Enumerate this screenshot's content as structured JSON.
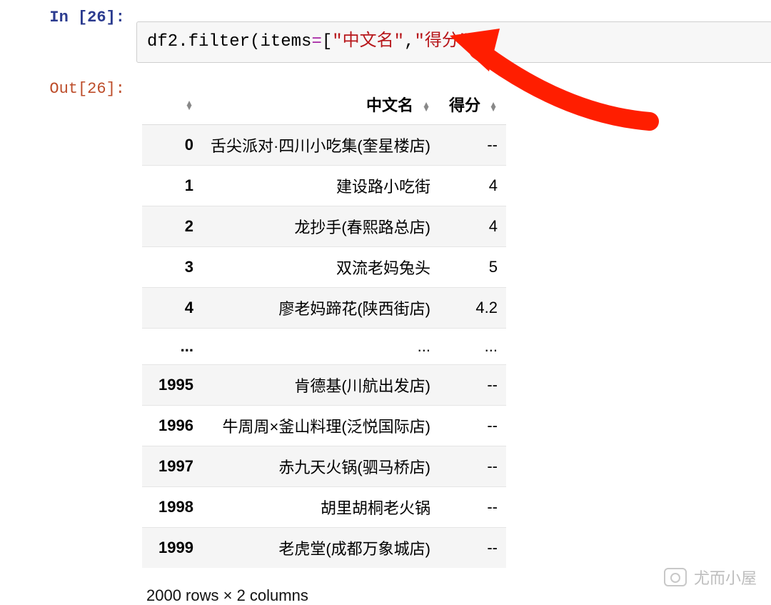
{
  "cell": {
    "in_label": "In [26]:",
    "out_label": "Out[26]:",
    "code": {
      "prefix": "df2.filter",
      "paren_open": "(",
      "kw": "items",
      "eq": "=",
      "br_open": "[",
      "s1": "\"中文名\"",
      "comma": ",",
      "s2": "\"得分\"",
      "br_close": "]",
      "paren_close": ")"
    }
  },
  "table": {
    "headers": {
      "index": "",
      "name": "中文名",
      "score": "得分"
    },
    "rows": [
      {
        "idx": "0",
        "name": "舌尖派对·四川小吃集(奎星楼店)",
        "score": "--"
      },
      {
        "idx": "1",
        "name": "建设路小吃街",
        "score": "4"
      },
      {
        "idx": "2",
        "name": "龙抄手(春熙路总店)",
        "score": "4"
      },
      {
        "idx": "3",
        "name": "双流老妈兔头",
        "score": "5"
      },
      {
        "idx": "4",
        "name": "廖老妈蹄花(陕西街店)",
        "score": "4.2"
      },
      {
        "idx": "...",
        "name": "...",
        "score": "..."
      },
      {
        "idx": "1995",
        "name": "肯德基(川航出发店)",
        "score": "--"
      },
      {
        "idx": "1996",
        "name": "牛周周×釜山料理(泛悦国际店)",
        "score": "--"
      },
      {
        "idx": "1997",
        "name": "赤九天火锅(驷马桥店)",
        "score": "--"
      },
      {
        "idx": "1998",
        "name": "胡里胡桐老火锅",
        "score": "--"
      },
      {
        "idx": "1999",
        "name": "老虎堂(成都万象城店)",
        "score": "--"
      }
    ],
    "summary": "2000 rows × 2 columns"
  },
  "watermark": {
    "text": "尤而小屋"
  }
}
